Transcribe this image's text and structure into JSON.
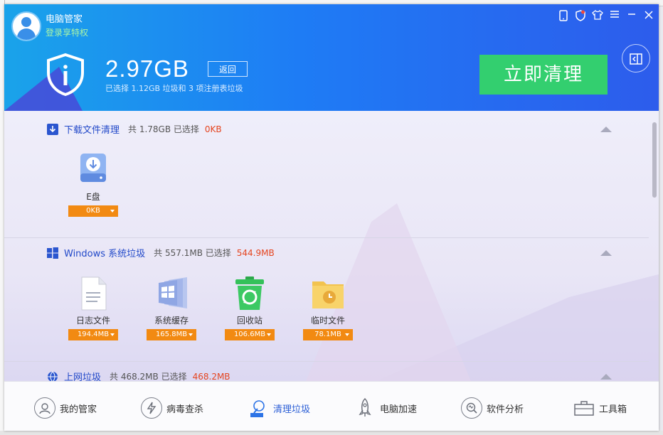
{
  "header": {
    "app_name": "电脑管家",
    "login_link": "登录享特权",
    "total_size": "2.97GB",
    "back_label": "返回",
    "subinfo": "已选择 1.12GB 垃圾和 3 项注册表垃圾",
    "clean_button": "立即清理"
  },
  "sections": [
    {
      "title": "下载文件清理",
      "info": "共 1.78GB 已选择",
      "selected": "0KB",
      "items": [
        {
          "label": "E盘",
          "size": "0KB",
          "icon": "drive-download-icon"
        }
      ]
    },
    {
      "title": "Windows 系统垃圾",
      "info": "共 557.1MB 已选择",
      "selected": "544.9MB",
      "items": [
        {
          "label": "日志文件",
          "size": "194.4MB",
          "icon": "document-icon"
        },
        {
          "label": "系统缓存",
          "size": "165.8MB",
          "icon": "windows-cache-icon"
        },
        {
          "label": "回收站",
          "size": "106.6MB",
          "icon": "recycle-bin-icon"
        },
        {
          "label": "临时文件",
          "size": "78.1MB",
          "icon": "temp-folder-icon"
        }
      ]
    },
    {
      "title": "上网垃圾",
      "info": "共 468.2MB 已选择",
      "selected": "468.2MB"
    }
  ],
  "nav": [
    {
      "label": "我的管家",
      "icon": "butler-icon"
    },
    {
      "label": "病毒查杀",
      "icon": "virus-scan-icon"
    },
    {
      "label": "清理垃圾",
      "icon": "vacuum-icon"
    },
    {
      "label": "电脑加速",
      "icon": "rocket-icon"
    },
    {
      "label": "软件分析",
      "icon": "analysis-icon"
    },
    {
      "label": "工具箱",
      "icon": "toolbox-icon"
    }
  ],
  "colors": {
    "accent_blue": "#1e7cf5",
    "clean_green": "#33cf6f",
    "pill_orange": "#f28a12",
    "selected_red": "#e5451f"
  }
}
